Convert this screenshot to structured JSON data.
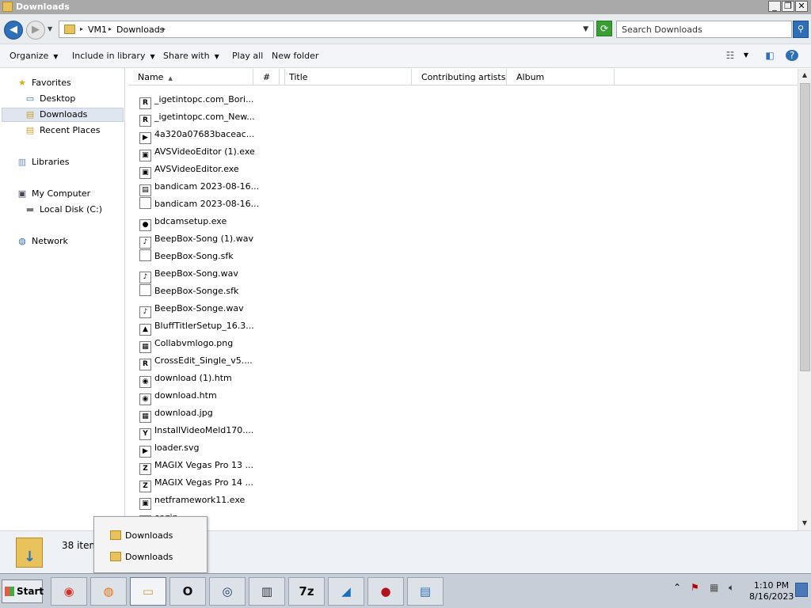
{
  "window": {
    "title": "Downloads",
    "buttons": {
      "minimize": "_",
      "restore": "❐",
      "close": "✕"
    }
  },
  "address": {
    "crumbs": [
      "VM1",
      "Downloads"
    ],
    "search_placeholder": "Search Downloads"
  },
  "toolbar": {
    "organize": "Organize",
    "include_in_library": "Include in library",
    "share_with": "Share with",
    "play_all": "Play all",
    "new_folder": "New folder"
  },
  "nav": {
    "favorites": "Favorites",
    "desktop": "Desktop",
    "downloads": "Downloads",
    "recent_places": "Recent Places",
    "libraries": "Libraries",
    "my_computer": "My Computer",
    "local_disk": "Local Disk (C:)",
    "network": "Network"
  },
  "columns": [
    "Name",
    "#",
    "Title",
    "Contributing artists",
    "Album"
  ],
  "files": [
    {
      "name": "_igetintopc.com_Bori...",
      "icon": "rar-icon",
      "glyph": "R"
    },
    {
      "name": "_igetintopc.com_New...",
      "icon": "rar-icon",
      "glyph": "R"
    },
    {
      "name": "4a320a07683baceac...",
      "icon": "media-icon",
      "glyph": "▶"
    },
    {
      "name": "AVSVideoEditor (1).exe",
      "icon": "installer-icon",
      "glyph": "▣"
    },
    {
      "name": "AVSVideoEditor.exe",
      "icon": "installer-icon",
      "glyph": "▣"
    },
    {
      "name": "bandicam 2023-08-16...",
      "icon": "video-file-icon",
      "glyph": "▤"
    },
    {
      "name": "bandicam 2023-08-16...",
      "icon": "blank-file-icon",
      "glyph": ""
    },
    {
      "name": "bdcamsetup.exe",
      "icon": "bandicam-icon",
      "glyph": "●"
    },
    {
      "name": "BeepBox-Song (1).wav",
      "icon": "audio-file-icon",
      "glyph": "♪"
    },
    {
      "name": "BeepBox-Song.sfk",
      "icon": "blank-file-icon",
      "glyph": ""
    },
    {
      "name": "BeepBox-Song.wav",
      "icon": "audio-file-icon",
      "glyph": "♪"
    },
    {
      "name": "BeepBox-Songe.sfk",
      "icon": "blank-file-icon",
      "glyph": ""
    },
    {
      "name": "BeepBox-Songe.wav",
      "icon": "audio-file-icon",
      "glyph": "♪"
    },
    {
      "name": "BluffTitlerSetup_16.3...",
      "icon": "setup-icon",
      "glyph": "▲"
    },
    {
      "name": "Collabvmlogo.png",
      "icon": "image-file-icon",
      "glyph": "▦"
    },
    {
      "name": "CrossEdit_Single_v5....",
      "icon": "rar-icon",
      "glyph": "R"
    },
    {
      "name": "download (1).htm",
      "icon": "chrome-icon",
      "glyph": "◉"
    },
    {
      "name": "download.htm",
      "icon": "chrome-icon",
      "glyph": "◉"
    },
    {
      "name": "download.jpg",
      "icon": "image-file-icon",
      "glyph": "▦"
    },
    {
      "name": "InstallVideoMeld170....",
      "icon": "installer-icon",
      "glyph": "Y"
    },
    {
      "name": "loader.svg",
      "icon": "media-icon",
      "glyph": "▶"
    },
    {
      "name": "MAGIX Vegas Pro 13 ...",
      "icon": "zip-icon",
      "glyph": "Z"
    },
    {
      "name": "MAGIX Vegas Pro 14 ...",
      "icon": "zip-icon",
      "glyph": "Z"
    },
    {
      "name": "netframework11.exe",
      "icon": "installer-icon",
      "glyph": "▣"
    },
    {
      "name": "er.zip",
      "icon": "zip-icon",
      "glyph": "Z"
    }
  ],
  "details": {
    "count": "38 item"
  },
  "popup": {
    "items": [
      "Downloads",
      "Downloads"
    ]
  },
  "taskbar": {
    "start": "Start",
    "apps": [
      {
        "name": "chrome-icon",
        "glyph": "◉",
        "color": "#d93025"
      },
      {
        "name": "firefox-icon",
        "glyph": "◍",
        "color": "#e8710a"
      },
      {
        "name": "explorer-icon",
        "glyph": "▭",
        "color": "#c9a23a"
      },
      {
        "name": "office-icon",
        "glyph": "O",
        "color": "#111111"
      },
      {
        "name": "disc-icon",
        "glyph": "◎",
        "color": "#1f3b66"
      },
      {
        "name": "film-icon",
        "glyph": "▥",
        "color": "#333333"
      },
      {
        "name": "7zip-icon",
        "glyph": "7z",
        "color": "#111111"
      },
      {
        "name": "video-editor-icon",
        "glyph": "◢",
        "color": "#1b6fb8"
      },
      {
        "name": "bandicam-icon",
        "glyph": "●",
        "color": "#b3131b"
      },
      {
        "name": "control-panel-icon",
        "glyph": "▤",
        "color": "#2f6fb8"
      }
    ],
    "time": "1:10 PM",
    "date": "8/16/2023"
  }
}
